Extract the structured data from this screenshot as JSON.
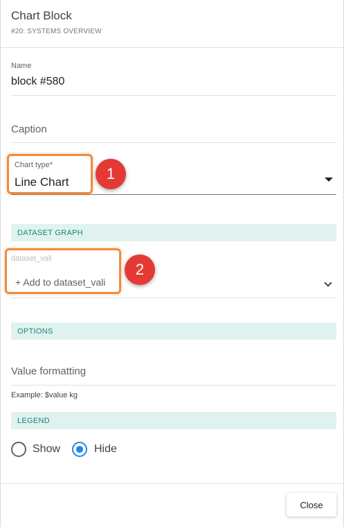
{
  "dialog": {
    "title": "Chart Block",
    "subtitle": "#20: SYSTEMS OVERVIEW"
  },
  "fields": {
    "name": {
      "label": "Name",
      "value": "block #580"
    },
    "caption": {
      "placeholder": "Caption"
    },
    "chart_type": {
      "label": "Chart type*",
      "value": "Line Chart"
    }
  },
  "sections": {
    "dataset_graph": "DATASET GRAPH",
    "options": "OPTIONS",
    "legend": "LEGEND"
  },
  "dataset": {
    "label": "dataset_vali",
    "add_label": "+ Add to dataset_vali"
  },
  "options": {
    "value_formatting_placeholder": "Value formatting",
    "example": "Example: $value kg"
  },
  "legend": {
    "options": [
      {
        "label": "Show",
        "selected": false
      },
      {
        "label": "Hide",
        "selected": true
      }
    ]
  },
  "footer": {
    "close_label": "Close"
  },
  "annotations": {
    "marker_1": "1",
    "marker_2": "2",
    "highlight_color": "#f08a3c",
    "marker_color": "#e53935"
  },
  "colors": {
    "accent": "#1e88e5",
    "section_band": "#e0f2ef",
    "section_text": "#13877b"
  }
}
